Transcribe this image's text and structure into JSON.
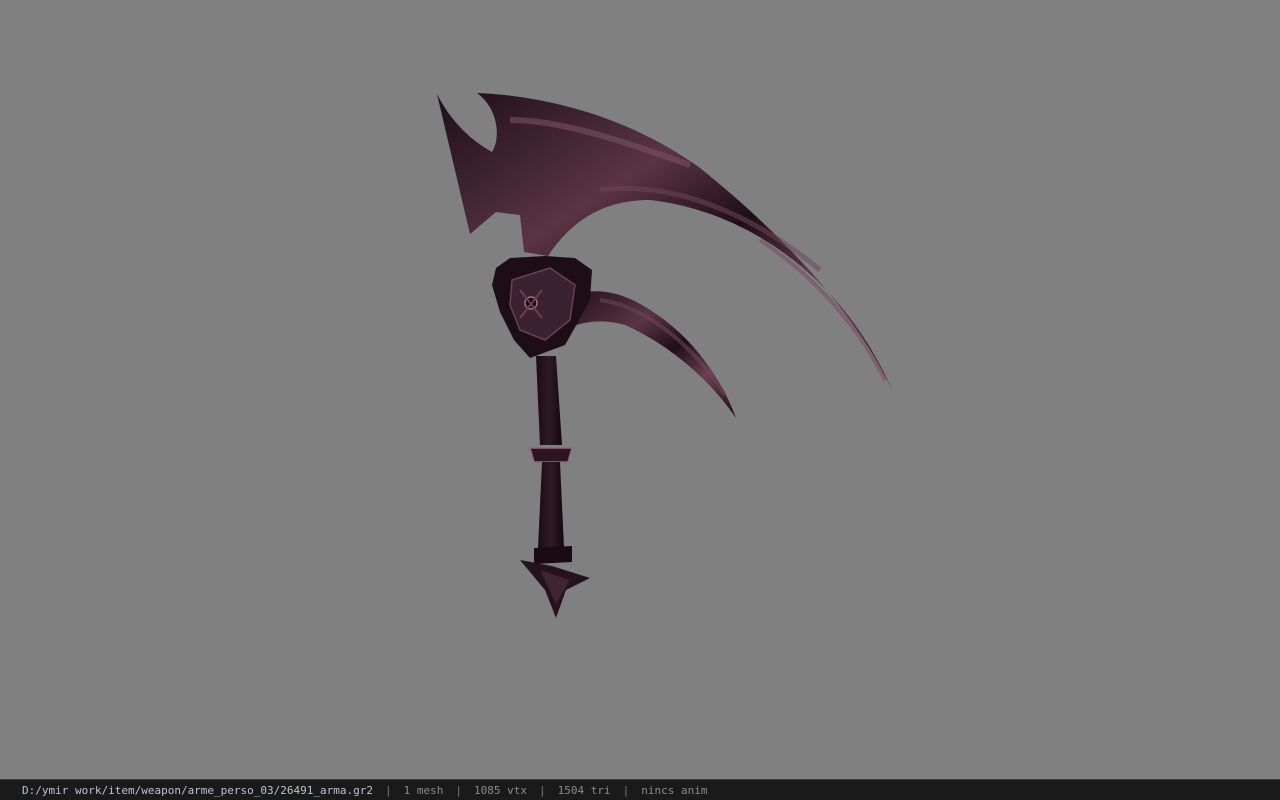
{
  "viewer": {
    "background_color": "#808080",
    "model_icon": "scythe-model"
  },
  "status_bar": {
    "file_path": "D:/ymir work/item/weapon/arme_perso_03/26491_arma.gr2",
    "separator": "|",
    "mesh_count": "1 mesh",
    "vertex_count": "1085 vtx",
    "triangle_count": "1504 tri",
    "animation": "nincs anim"
  }
}
